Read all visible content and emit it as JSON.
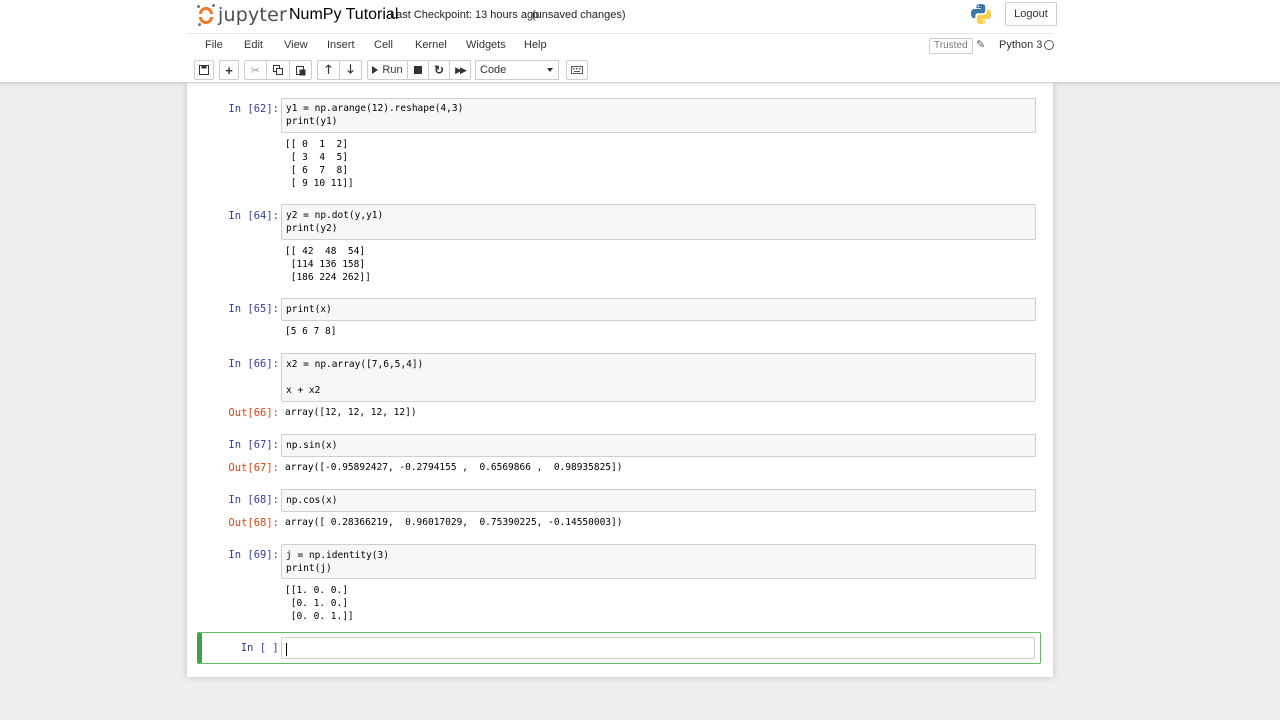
{
  "header": {
    "logo_text": "jupyter",
    "notebook_name": "NumPy Tutorial",
    "checkpoint": "Last Checkpoint: 13 hours ago",
    "autosave": "(unsaved changes)",
    "logout_label": "Logout"
  },
  "menu": {
    "items": [
      {
        "label": "File"
      },
      {
        "label": "Edit"
      },
      {
        "label": "View"
      },
      {
        "label": "Insert"
      },
      {
        "label": "Cell"
      },
      {
        "label": "Kernel"
      },
      {
        "label": "Widgets"
      },
      {
        "label": "Help"
      }
    ],
    "trusted": "Trusted",
    "kernel_name": "Python 3"
  },
  "toolbar": {
    "run_label": "Run",
    "cell_type": "Code",
    "icons": [
      "save-icon",
      "plus-icon",
      "cut-icon",
      "copy-icon",
      "paste-icon",
      "arrow-up-icon",
      "arrow-down-icon",
      "run-icon",
      "stop-icon",
      "restart-icon",
      "fast-forward-icon",
      "keyboard-icon"
    ]
  },
  "cells": [
    {
      "prompt": "In [62]:",
      "code": [
        "y1 = np.arange(12).reshape(4,3)",
        "print(y1)"
      ],
      "output": [
        "[[ 0  1  2]",
        " [ 3  4  5]",
        " [ 6  7  8]",
        " [ 9 10 11]]"
      ],
      "out_prompt": ""
    },
    {
      "prompt": "In [64]:",
      "code": [
        "y2 = np.dot(y,y1)",
        "print(y2)"
      ],
      "output": [
        "[[ 42  48  54]",
        " [114 136 158]",
        " [186 224 262]]"
      ],
      "out_prompt": ""
    },
    {
      "prompt": "In [65]:",
      "code": [
        "print(x)"
      ],
      "output": [
        "[5 6 7 8]"
      ],
      "out_prompt": ""
    },
    {
      "prompt": "In [66]:",
      "code": [
        "x2 = np.array([7,6,5,4])",
        "",
        "x + x2"
      ],
      "output": [
        "array([12, 12, 12, 12])"
      ],
      "out_prompt": "Out[66]:"
    },
    {
      "prompt": "In [67]:",
      "code": [
        "np.sin(x)"
      ],
      "output": [
        "array([-0.95892427, -0.2794155 ,  0.6569866 ,  0.98935825])"
      ],
      "out_prompt": "Out[67]:"
    },
    {
      "prompt": "In [68]:",
      "code": [
        "np.cos(x)"
      ],
      "output": [
        "array([ 0.28366219,  0.96017029,  0.75390225, -0.14550003])"
      ],
      "out_prompt": "Out[68]:"
    },
    {
      "prompt": "In [69]:",
      "code": [
        "j = np.identity(3)",
        "print(j)"
      ],
      "output": [
        "[[1. 0. 0.]",
        " [0. 1. 0.]",
        " [0. 0. 1.]]"
      ],
      "out_prompt": ""
    }
  ],
  "empty_cell": {
    "prompt": "In [ ]:"
  },
  "colors": {
    "in_prompt": "#303f9f",
    "out_prompt": "#d84315",
    "selected_border": "#42a047",
    "logo_orange": "#f37726"
  }
}
